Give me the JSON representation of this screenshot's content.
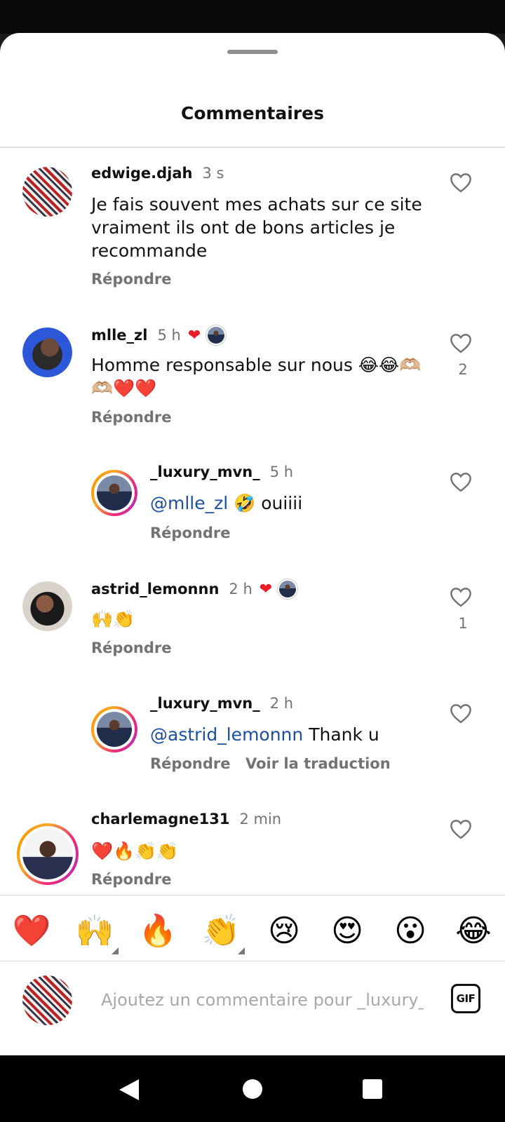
{
  "sheet": {
    "title": "Commentaires"
  },
  "comments": [
    {
      "username": "edwige.djah",
      "time": "3 s",
      "text": "Je fais souvent mes achats sur ce site vraiment ils ont de bons articles je recommande",
      "reply_label": "Répondre",
      "likes": ""
    },
    {
      "username": "mlle_zl",
      "time": "5 h",
      "text": "Homme responsable sur nous 😂😂🫶🏼🫶🏼❤️❤️",
      "reply_label": "Répondre",
      "likes": "2"
    },
    {
      "username": "_luxury_mvn_",
      "time": "5 h",
      "mention": "@mlle_zl",
      "text": " 🤣 ouiiii",
      "reply_label": "Répondre",
      "likes": ""
    },
    {
      "username": "astrid_lemonnn",
      "time": "2 h",
      "text": "🙌👏",
      "reply_label": "Répondre",
      "likes": "1"
    },
    {
      "username": "_luxury_mvn_",
      "time": "2 h",
      "mention": "@astrid_lemonnn",
      "text": " Thank u",
      "reply_label": "Répondre",
      "translate_label": "Voir la traduction",
      "likes": ""
    },
    {
      "username": "charlemagne131",
      "time": "2 min",
      "text": "❤️🔥👏👏",
      "reply_label": "Répondre",
      "likes": ""
    }
  ],
  "quick_reactions": [
    "❤️",
    "🙌",
    "🔥",
    "👏",
    "😢",
    "😍",
    "😮",
    "😂"
  ],
  "composer": {
    "placeholder": "Ajoutez un commentaire pour _luxury_mvn_...",
    "gif_label": "GIF"
  },
  "colors": {
    "like_heart": "#ed1c24",
    "mention": "#1d4fa0",
    "muted": "#737373"
  }
}
